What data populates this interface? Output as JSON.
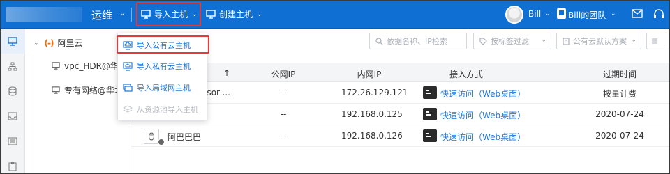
{
  "header": {
    "title": "运维",
    "import_label": "导入主机",
    "create_label": "创建主机",
    "user_name": "Bill",
    "team_name": "Bill的团队"
  },
  "tree": {
    "root_label": "阿里云",
    "nodes": [
      "vpc_HDR@华南",
      "专有网络@华北"
    ]
  },
  "toolbar": {
    "search_placeholder": "依据名称、IP检索",
    "tag_filter_placeholder": "按标签过滤",
    "scheme_placeholder": "公有云默认方案"
  },
  "dropdown": {
    "items": [
      "导入公有云主机",
      "导入私有云主机",
      "导入局域网主机",
      "从资源池导入主机"
    ],
    "highlighted_index": 0,
    "disabled_index": 3
  },
  "table": {
    "columns": [
      "公网IP",
      "内网IP",
      "接入方式",
      "过期时间"
    ],
    "sort_indicator": "↑",
    "rows": [
      {
        "name": "visor-...",
        "public_ip": "--",
        "private_ip": "172.26.129.121",
        "access": "快速访问（Web桌面）",
        "expire": "按量计费"
      },
      {
        "name": "",
        "public_ip": "--",
        "private_ip": "192.168.0.125",
        "access": "快速访问（Web桌面）",
        "expire": "2020-07-24"
      },
      {
        "name": "阿巴巴巴",
        "public_ip": "--",
        "private_ip": "192.168.0.126",
        "access": "快速访问（Web桌面）",
        "expire": "2020-07-24"
      }
    ]
  },
  "colors": {
    "header_bg": "#0f6fd2",
    "highlight_border": "#e53a3a",
    "link": "#1f74d6",
    "brand_orange": "#ff6a00"
  }
}
